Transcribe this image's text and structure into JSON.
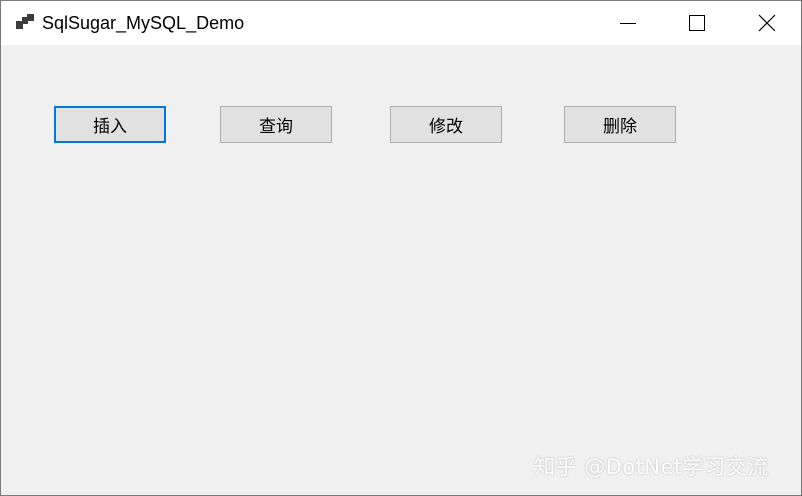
{
  "window": {
    "title": "SqlSugar_MySQL_Demo",
    "caption_icons": {
      "minimize": "minimize-icon",
      "maximize": "maximize-icon",
      "close": "close-icon"
    }
  },
  "buttons": [
    {
      "label": "插入",
      "focused": true
    },
    {
      "label": "查询",
      "focused": false
    },
    {
      "label": "修改",
      "focused": false
    },
    {
      "label": "删除",
      "focused": false
    }
  ],
  "watermark": "知乎 @DotNet学习交流",
  "colors": {
    "focus_border": "#0078d7",
    "button_face": "#e1e1e1",
    "client_bg": "#f0f0f0"
  }
}
